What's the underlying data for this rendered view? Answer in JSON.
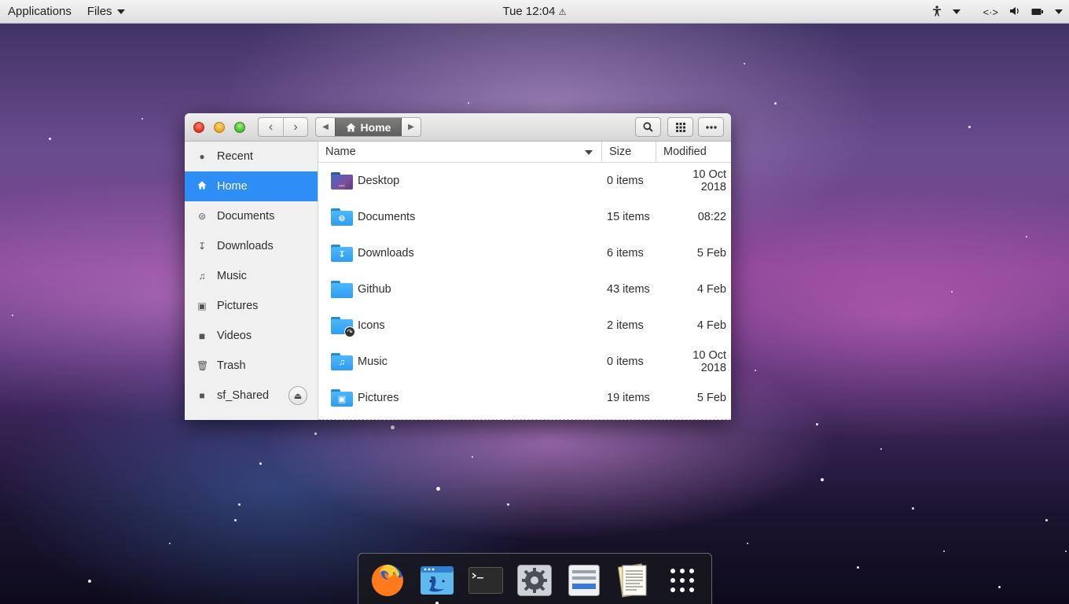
{
  "topbar": {
    "applications": "Applications",
    "files_menu": "Files",
    "clock": "Tue 12:04",
    "tray_icons": [
      "accessibility-icon",
      "network-icon",
      "volume-icon",
      "battery-icon"
    ]
  },
  "window": {
    "breadcrumb": {
      "current": "Home"
    },
    "sidebar": {
      "items": [
        {
          "label": "Recent",
          "icon": "clock-icon"
        },
        {
          "label": "Home",
          "icon": "home-icon",
          "active": true
        },
        {
          "label": "Documents",
          "icon": "documents-icon"
        },
        {
          "label": "Downloads",
          "icon": "download-icon"
        },
        {
          "label": "Music",
          "icon": "music-icon"
        },
        {
          "label": "Pictures",
          "icon": "pictures-icon"
        },
        {
          "label": "Videos",
          "icon": "video-icon"
        },
        {
          "label": "Trash",
          "icon": "trash-icon"
        },
        {
          "label": "sf_Shared",
          "icon": "drive-icon"
        }
      ]
    },
    "columns": {
      "name": "Name",
      "size": "Size",
      "modified": "Modified"
    },
    "rows": [
      {
        "name": "Desktop",
        "size": "0 items",
        "modified": "10 Oct 2018",
        "icon": "desktop-folder-icon"
      },
      {
        "name": "Documents",
        "size": "15 items",
        "modified": "08:22",
        "icon": "documents-folder-icon"
      },
      {
        "name": "Downloads",
        "size": "6 items",
        "modified": "5 Feb",
        "icon": "downloads-folder-icon"
      },
      {
        "name": "Github",
        "size": "43 items",
        "modified": "4 Feb",
        "icon": "folder-icon"
      },
      {
        "name": "Icons",
        "size": "2 items",
        "modified": "4 Feb",
        "icon": "symlink-folder-icon"
      },
      {
        "name": "Music",
        "size": "0 items",
        "modified": "10 Oct 2018",
        "icon": "music-folder-icon"
      },
      {
        "name": "Pictures",
        "size": "19 items",
        "modified": "5 Feb",
        "icon": "pictures-folder-icon"
      }
    ]
  },
  "dock": {
    "items": [
      "firefox-icon",
      "finder-icon",
      "terminal-icon",
      "settings-icon",
      "software-icon",
      "text-editor-icon",
      "app-grid-icon"
    ]
  }
}
